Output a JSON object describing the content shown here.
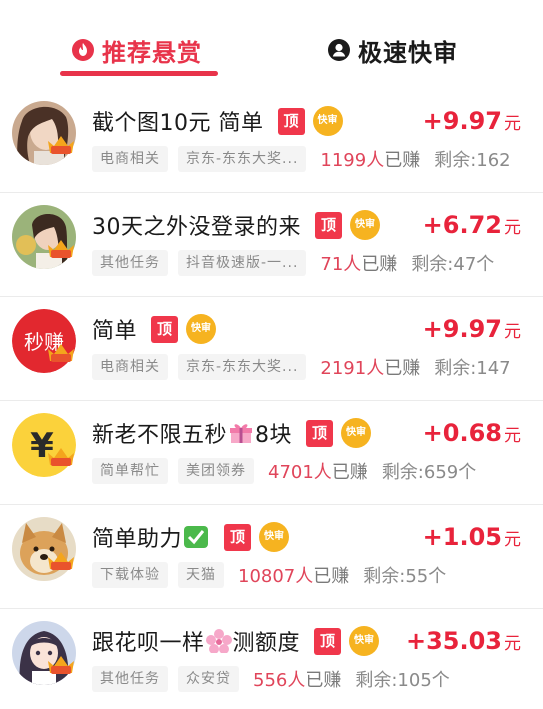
{
  "tabs": {
    "recommended": "推荐悬赏",
    "fast_review": "极速快审"
  },
  "badges": {
    "top": "顶",
    "fast": "快审",
    "avatar_badge": "快审"
  },
  "colors": {
    "accent": "#e8334a",
    "reward": "#e8233b",
    "fast_badge": "#f6b320"
  },
  "tasks": [
    {
      "title": "截个图10元 简单",
      "reward": "+9.97",
      "unit": "元",
      "tag1": "电商相关",
      "tag2": "京东-东东大奖...",
      "earned_count": "1199人",
      "earned_suffix": "已赚",
      "remaining": "剩余:162",
      "avatar": "woman-photo"
    },
    {
      "title": "30天之外没登录的来",
      "reward": "+6.72",
      "unit": "元",
      "tag1": "其他任务",
      "tag2": "抖音极速版-一...",
      "earned_count": "71人",
      "earned_suffix": "已赚",
      "remaining": "剩余:47个",
      "avatar": "woman-photo-2"
    },
    {
      "title": "简单",
      "reward": "+9.97",
      "unit": "元",
      "tag1": "电商相关",
      "tag2": "京东-东东大奖...",
      "earned_count": "2191人",
      "earned_suffix": "已赚",
      "remaining": "剩余:147",
      "avatar": "miaozhuan-logo",
      "avatar_text": "秒赚"
    },
    {
      "title_before": "新老不限五秒",
      "title_after": "8块",
      "emoji": "gift-icon",
      "reward": "+0.68",
      "unit": "元",
      "tag1": "简单帮忙",
      "tag2": "美团领券",
      "earned_count": "4701人",
      "earned_suffix": "已赚",
      "remaining": "剩余:659个",
      "avatar": "yen-coin",
      "avatar_text": "¥"
    },
    {
      "title": "简单助力",
      "emoji": "check-mark-icon",
      "reward": "+1.05",
      "unit": "元",
      "tag1": "下载体验",
      "tag2": "天猫",
      "earned_count": "10807人",
      "earned_suffix": "已赚",
      "remaining": "剩余:55个",
      "avatar": "doge-photo"
    },
    {
      "title_before": "跟花呗一样",
      "title_after": "测额度",
      "emoji": "cherry-blossom-icon",
      "reward": "+35.03",
      "unit": "元",
      "tag1": "其他任务",
      "tag2": "众安贷",
      "earned_count": "556人",
      "earned_suffix": "已赚",
      "remaining": "剩余:105个",
      "avatar": "anime-girl-photo"
    }
  ]
}
